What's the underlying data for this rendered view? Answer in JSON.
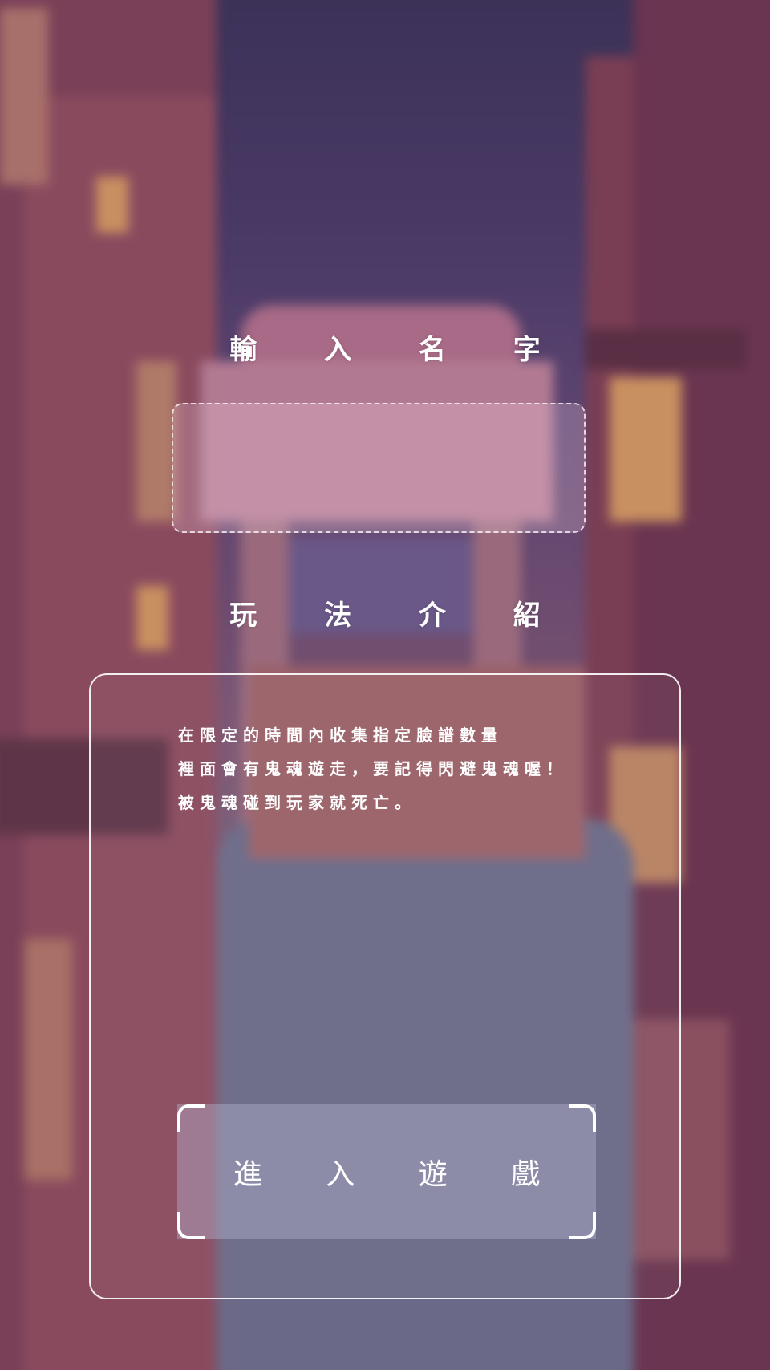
{
  "colors": {
    "text": "#ffffff",
    "sky_top": "#3c3258",
    "street": "#6a6a88",
    "building": "#8a4a5e",
    "lantern": "#c89060"
  },
  "name_section": {
    "title": "輸 入 名 字",
    "input_value": "",
    "input_placeholder": ""
  },
  "howto_section": {
    "title": "玩 法 介 紹",
    "lines": [
      "在限定的時間內收集指定臉譜數量",
      "裡面會有鬼魂遊走，要記得閃避鬼魂喔！",
      "被鬼魂碰到玩家就死亡。"
    ]
  },
  "start_button": {
    "label": "進 入 遊 戲"
  },
  "background": {
    "scene": "blurred-old-street-with-gate-icon"
  }
}
